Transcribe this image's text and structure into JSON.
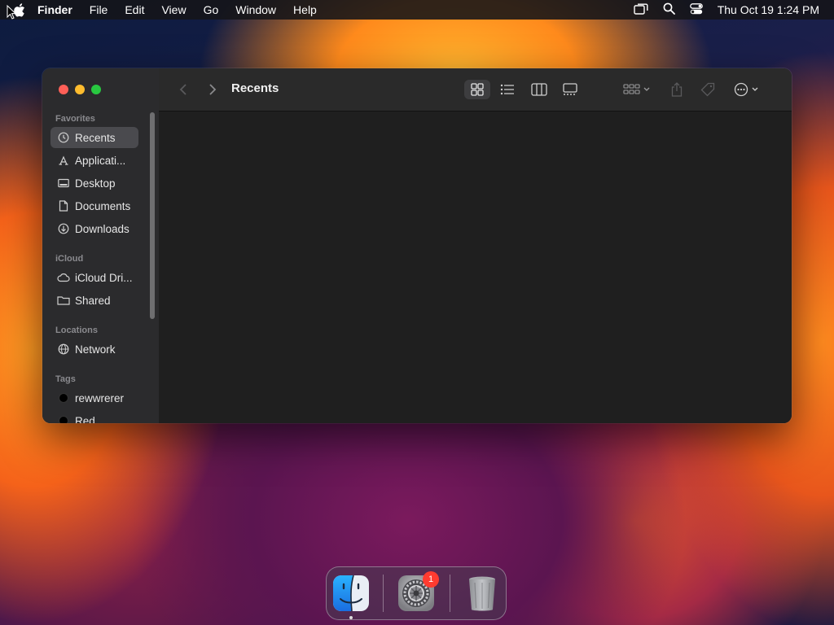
{
  "menubar": {
    "app_name": "Finder",
    "menus": [
      "File",
      "Edit",
      "View",
      "Go",
      "Window",
      "Help"
    ],
    "clock": "Thu Oct 19  1:24 PM"
  },
  "finder": {
    "title": "Recents",
    "sidebar": {
      "favorites_header": "Favorites",
      "favorites": [
        {
          "label": "Recents",
          "icon": "clock-icon",
          "selected": true
        },
        {
          "label": "Applicati...",
          "icon": "applications-icon"
        },
        {
          "label": "Desktop",
          "icon": "desktop-icon"
        },
        {
          "label": "Documents",
          "icon": "document-icon"
        },
        {
          "label": "Downloads",
          "icon": "download-icon"
        }
      ],
      "icloud_header": "iCloud",
      "icloud": [
        {
          "label": "iCloud Dri...",
          "icon": "cloud-icon"
        },
        {
          "label": "Shared",
          "icon": "shared-folder-icon"
        }
      ],
      "locations_header": "Locations",
      "locations": [
        {
          "label": "Network",
          "icon": "globe-icon"
        }
      ],
      "tags_header": "Tags",
      "tags": [
        {
          "label": "rewwrerer",
          "color": "#000000"
        },
        {
          "label": "Red",
          "color": "#000000"
        }
      ]
    },
    "toolbar_icons": [
      "back-icon",
      "forward-icon",
      "icon-view-icon",
      "list-view-icon",
      "column-view-icon",
      "gallery-view-icon",
      "group-icon",
      "share-icon",
      "tag-icon",
      "more-icon",
      "search-icon"
    ]
  },
  "dock": {
    "apps": [
      "finder-icon",
      "system-settings-icon",
      "trash-icon"
    ],
    "settings_badge": "1"
  }
}
